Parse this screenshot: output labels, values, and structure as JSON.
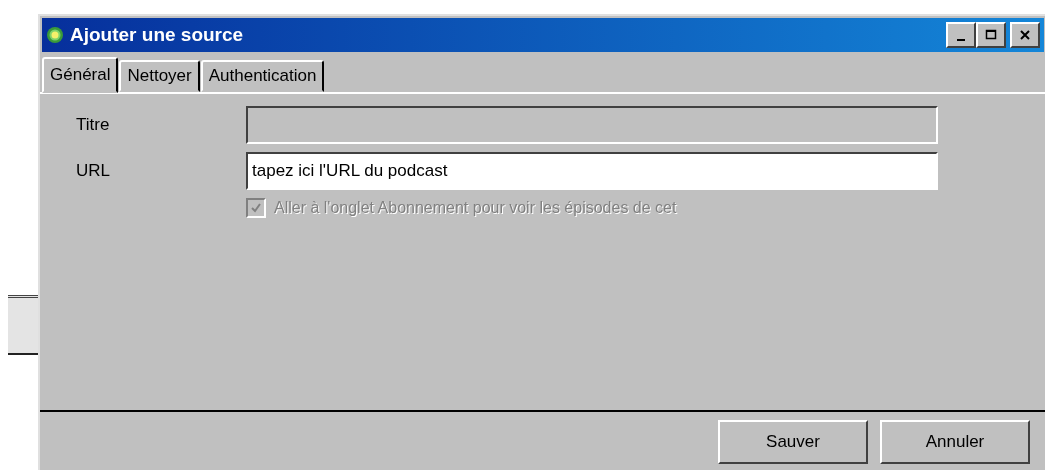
{
  "window": {
    "title": "Ajouter une source"
  },
  "tabs": [
    {
      "label": "Général",
      "selected": true
    },
    {
      "label": "Nettoyer",
      "selected": false
    },
    {
      "label": "Authentication",
      "selected": false
    }
  ],
  "fields": [
    {
      "label": "Titre",
      "disabled": true
    },
    {
      "label": "URL",
      "value": "tapez ici l'URL du podcast",
      "disabled": false
    }
  ],
  "option": {
    "label": "Aller à l'onglet Abonnement pour voir les épisodes de cet",
    "checked": true,
    "disabled": true
  },
  "buttons": [
    "Sauver",
    "Annuler"
  ]
}
